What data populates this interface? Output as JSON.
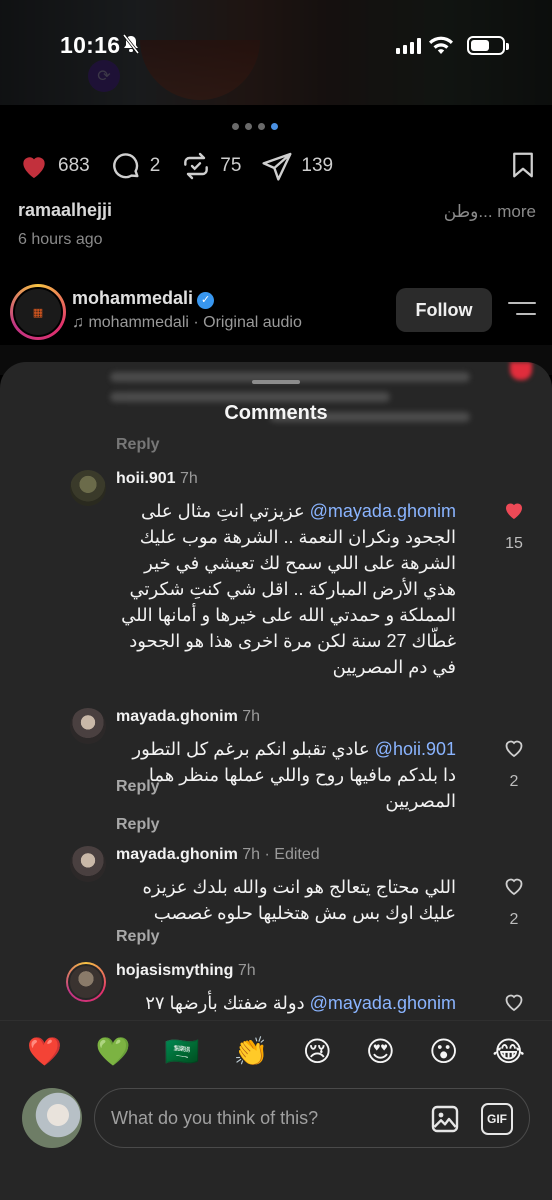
{
  "status_bar": {
    "time": "10:16"
  },
  "post": {
    "carousel_dots": 4,
    "active_dot": 3,
    "likes": "683",
    "comments": "2",
    "reposts": "75",
    "shares": "139",
    "username": "ramaalhejji",
    "caption_more": "وطن... more",
    "time_ago": "6 hours ago"
  },
  "reel": {
    "username": "mohammedali",
    "audio": "mohammedali · Original audio",
    "follow_label": "Follow"
  },
  "sheet": {
    "title": "Comments",
    "faded_reply": "Reply"
  },
  "comments": [
    {
      "username": "hoii.901",
      "meta": "7h",
      "mention": "@mayada.ghonim",
      "text": "عزيزتي انتِ مثال على الجحود  ونكران النعمة .. الشرهة موب عليك الشرهة على اللي سمح لك تعيشي في خير هذي الأرض المباركة .. اقل شي كنتِ شكرتي المملكة و حمدتي الله على خيرها و أمانها اللي غطّاك 27 سنة لكن مرة اخرى هذا هو الجحود في دم المصريين",
      "reply": "Reply",
      "likes": "15",
      "liked": true
    },
    {
      "username": "mayada.ghonim",
      "meta": "7h",
      "mention": "@hoii.901",
      "text": "عادي تقبلو انكم برغم كل التطور دا بلدكم مافيها روح  واللي عملها  منظر هما المصريين",
      "reply": "Reply",
      "likes": "2",
      "liked": false
    },
    {
      "username": "mayada.ghonim",
      "meta": "7h · Edited",
      "mention": "",
      "text": "اللي محتاج يتعالج هو انت والله بلدك عزيزه عليك اوك بس مش هتخليها حلوه غصصب",
      "reply": "Reply",
      "likes": "2",
      "liked": false
    },
    {
      "username": "hojasismything",
      "meta": "7h",
      "mention": "@mayada.ghonim",
      "text": "دولة ضفتك بأرضها ٢٧",
      "reply": "",
      "likes": "",
      "liked": false
    }
  ],
  "emoji_bar": [
    "❤️",
    "💚",
    "🇸🇦",
    "👏",
    "😢",
    "😍",
    "😮",
    "😂"
  ],
  "input": {
    "placeholder": "What do you think of this?",
    "gif_label": "GIF"
  },
  "colors": {
    "like_red": "#ed4956",
    "mention_blue": "#8ab4ff",
    "sheet_bg": "#262626"
  }
}
